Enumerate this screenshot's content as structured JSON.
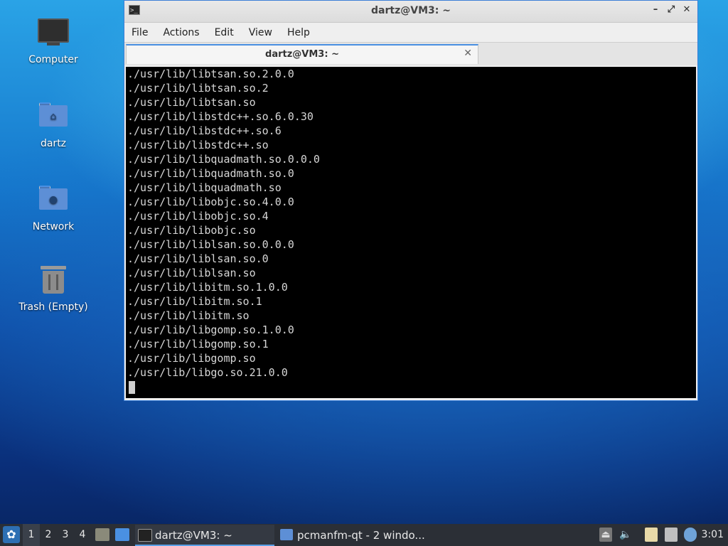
{
  "desktop": {
    "icons": [
      {
        "label": "Computer",
        "icon": "computer-icon"
      },
      {
        "label": "dartz",
        "icon": "home-folder-icon"
      },
      {
        "label": "Network",
        "icon": "network-folder-icon"
      },
      {
        "label": "Trash (Empty)",
        "icon": "trash-icon"
      }
    ]
  },
  "window": {
    "title": "dartz@VM3: ~",
    "controls": {
      "minimize": "–",
      "maximize": "⤢",
      "close": "✕"
    },
    "menu": [
      "File",
      "Actions",
      "Edit",
      "View",
      "Help"
    ],
    "tab": {
      "label": "dartz@VM3: ~",
      "close": "✕"
    },
    "terminal_lines": [
      "./usr/lib/libtsan.so.2.0.0",
      "./usr/lib/libtsan.so.2",
      "./usr/lib/libtsan.so",
      "./usr/lib/libstdc++.so.6.0.30",
      "./usr/lib/libstdc++.so.6",
      "./usr/lib/libstdc++.so",
      "./usr/lib/libquadmath.so.0.0.0",
      "./usr/lib/libquadmath.so.0",
      "./usr/lib/libquadmath.so",
      "./usr/lib/libobjc.so.4.0.0",
      "./usr/lib/libobjc.so.4",
      "./usr/lib/libobjc.so",
      "./usr/lib/liblsan.so.0.0.0",
      "./usr/lib/liblsan.so.0",
      "./usr/lib/liblsan.so",
      "./usr/lib/libitm.so.1.0.0",
      "./usr/lib/libitm.so.1",
      "./usr/lib/libitm.so",
      "./usr/lib/libgomp.so.1.0.0",
      "./usr/lib/libgomp.so.1",
      "./usr/lib/libgomp.so",
      "./usr/lib/libgo.so.21.0.0"
    ]
  },
  "taskbar": {
    "workspaces": [
      "1",
      "2",
      "3",
      "4"
    ],
    "tasks": [
      {
        "label": "dartz@VM3: ~",
        "icon": "terminal-icon"
      },
      {
        "label": "pcmanfm-qt - 2 windo...",
        "icon": "folder-icon"
      }
    ],
    "tray_icons": [
      "eject-icon",
      "volume-icon",
      "clipboard-icon",
      "network-icon",
      "update-icon"
    ],
    "clock": "3:01"
  },
  "colors": {
    "accent": "#4a90e2",
    "taskbar": "#2b2f36",
    "terminal_bg": "#000000"
  }
}
